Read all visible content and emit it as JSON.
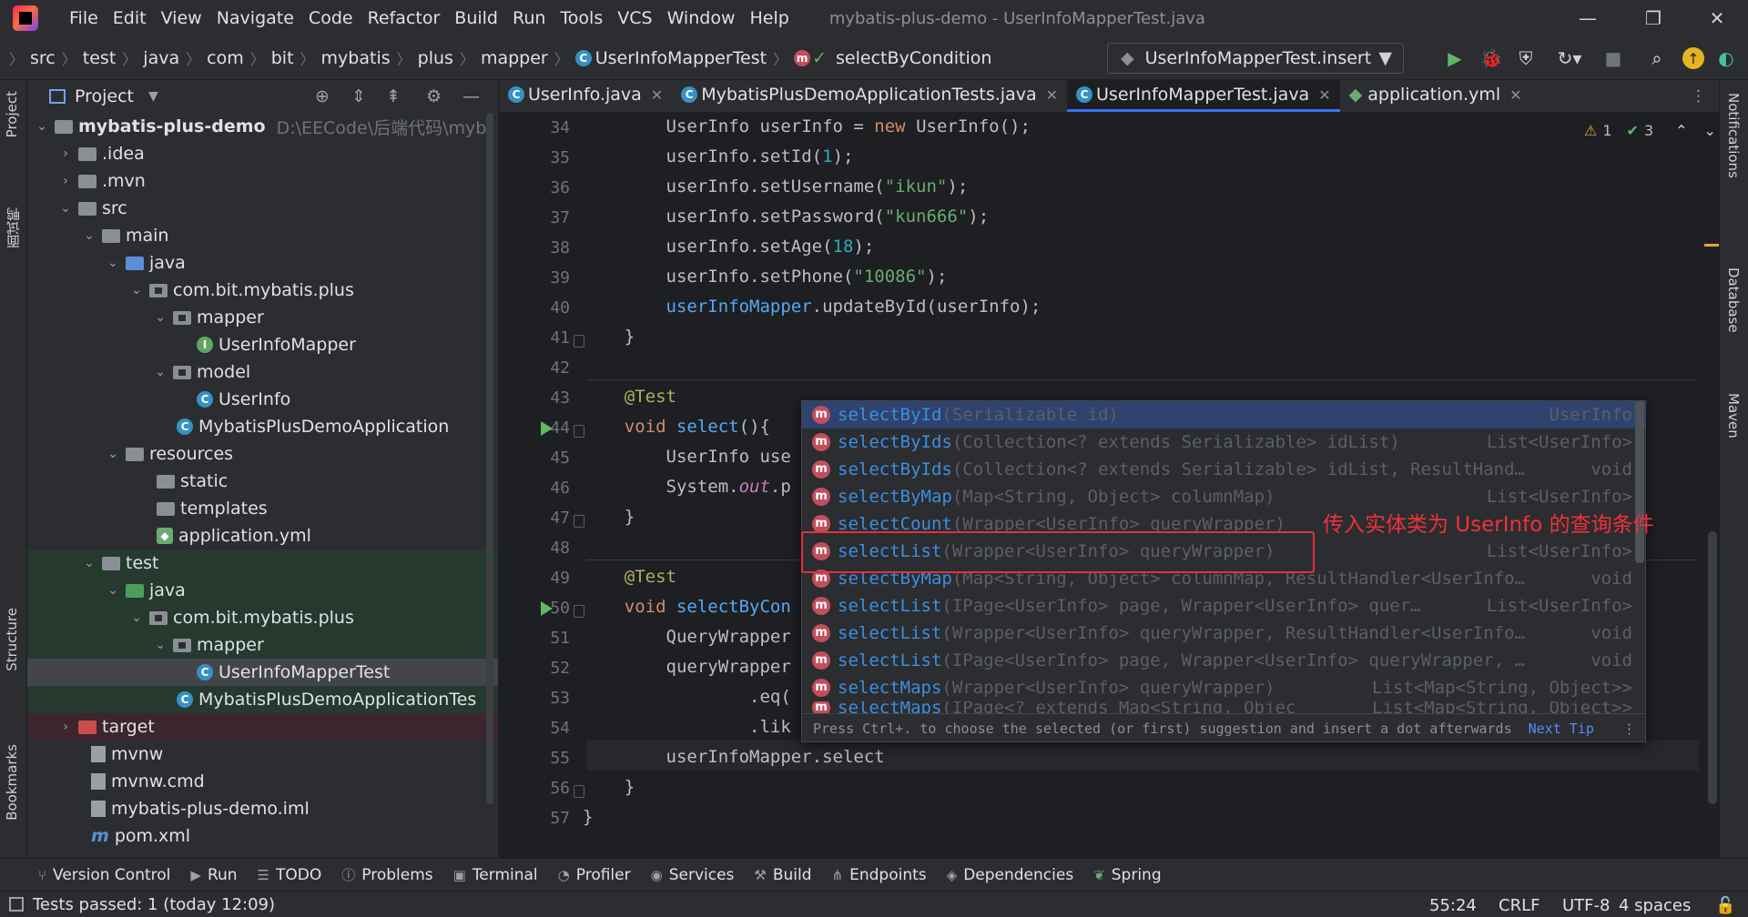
{
  "title_bar": {
    "menu": [
      "File",
      "Edit",
      "View",
      "Navigate",
      "Code",
      "Refactor",
      "Build",
      "Run",
      "Tools",
      "VCS",
      "Window",
      "Help"
    ],
    "window_title": "mybatis-plus-demo - UserInfoMapperTest.java"
  },
  "nav_bar": {
    "breadcrumb": [
      "src",
      "test",
      "java",
      "com",
      "bit",
      "mybatis",
      "plus",
      "mapper",
      "UserInfoMapperTest",
      "selectByCondition"
    ],
    "run_config": "UserInfoMapperTest.insert"
  },
  "project_panel": {
    "title": "Project",
    "tree": [
      {
        "label": "mybatis-plus-demo",
        "extra": "D:\\EECode\\后端代码\\myb"
      },
      {
        "label": ".idea"
      },
      {
        "label": ".mvn"
      },
      {
        "label": "src"
      },
      {
        "label": "main"
      },
      {
        "label": "java"
      },
      {
        "label": "com.bit.mybatis.plus"
      },
      {
        "label": "mapper"
      },
      {
        "label": "UserInfoMapper"
      },
      {
        "label": "model"
      },
      {
        "label": "UserInfo"
      },
      {
        "label": "MybatisPlusDemoApplication"
      },
      {
        "label": "resources"
      },
      {
        "label": "static"
      },
      {
        "label": "templates"
      },
      {
        "label": "application.yml"
      },
      {
        "label": "test"
      },
      {
        "label": "java"
      },
      {
        "label": "com.bit.mybatis.plus"
      },
      {
        "label": "mapper"
      },
      {
        "label": "UserInfoMapperTest"
      },
      {
        "label": "MybatisPlusDemoApplicationTes"
      },
      {
        "label": "target"
      },
      {
        "label": "mvnw"
      },
      {
        "label": "mvnw.cmd"
      },
      {
        "label": "mybatis-plus-demo.iml"
      },
      {
        "label": "pom.xml"
      }
    ]
  },
  "tabs": [
    {
      "label": "UserInfo.java"
    },
    {
      "label": "MybatisPlusDemoApplicationTests.java"
    },
    {
      "label": "UserInfoMapperTest.java"
    },
    {
      "label": "application.yml"
    }
  ],
  "editor": {
    "inspection_warnings": "1",
    "inspection_ok": "3",
    "line_numbers": [
      "34",
      "35",
      "36",
      "37",
      "38",
      "39",
      "40",
      "41",
      "42",
      "43",
      "44",
      "45",
      "46",
      "47",
      "48",
      "49",
      "50",
      "51",
      "52",
      "53",
      "54",
      "55",
      "56",
      "57"
    ]
  },
  "completion": {
    "items": [
      {
        "name": "selectById",
        "params": "(Serializable id)",
        "ret": "UserInfo"
      },
      {
        "name": "selectByIds",
        "params": "(Collection<? extends Serializable> idList)",
        "ret": "List<UserInfo>"
      },
      {
        "name": "selectByIds",
        "params": "(Collection<? extends Serializable> idList, ResultHand…",
        "ret": "void"
      },
      {
        "name": "selectByMap",
        "params": "(Map<String, Object> columnMap)",
        "ret": "List<UserInfo>"
      },
      {
        "name": "selectCount",
        "params": "(Wrapper<UserInfo> queryWrapper)",
        "ret": ""
      },
      {
        "name": "selectList",
        "params": "(Wrapper<UserInfo> queryWrapper)",
        "ret": "List<UserInfo>"
      },
      {
        "name": "selectByMap",
        "params": "(Map<String, Object> columnMap, ResultHandler<UserInfo…",
        "ret": "void"
      },
      {
        "name": "selectList",
        "params": "(IPage<UserInfo> page, Wrapper<UserInfo> quer…",
        "ret": "List<UserInfo>"
      },
      {
        "name": "selectList",
        "params": "(Wrapper<UserInfo> queryWrapper, ResultHandler<UserInfo…",
        "ret": "void"
      },
      {
        "name": "selectList",
        "params": "(IPage<UserInfo> page, Wrapper<UserInfo> queryWrapper, …",
        "ret": "void"
      },
      {
        "name": "selectMaps",
        "params": "(Wrapper<UserInfo> queryWrapper)",
        "ret": "List<Map<String, Object>>"
      },
      {
        "name": "selectMaps",
        "params": "(IPage<? extends Map<String, Objec",
        "ret": "List<Map<String, Object>>"
      }
    ],
    "footer": "Press Ctrl+. to choose the selected (or first) suggestion and insert a dot afterwards",
    "next_tip": "Next Tip",
    "annotation": "传入实体类为 UserInfo 的查询条件"
  },
  "right_strip": [
    "Notifications",
    "Database",
    "Maven"
  ],
  "left_strip": [
    "Project",
    "面试鸭",
    "Structure",
    "Bookmarks"
  ],
  "bottom_tools": [
    "Version Control",
    "Run",
    "TODO",
    "Problems",
    "Terminal",
    "Profiler",
    "Services",
    "Build",
    "Endpoints",
    "Dependencies",
    "Spring"
  ],
  "status_bar": {
    "message": "Tests passed: 1 (today 12:09)",
    "position": "55:24",
    "line_sep": "CRLF",
    "encoding": "UTF-8",
    "indent": "4 spaces"
  }
}
